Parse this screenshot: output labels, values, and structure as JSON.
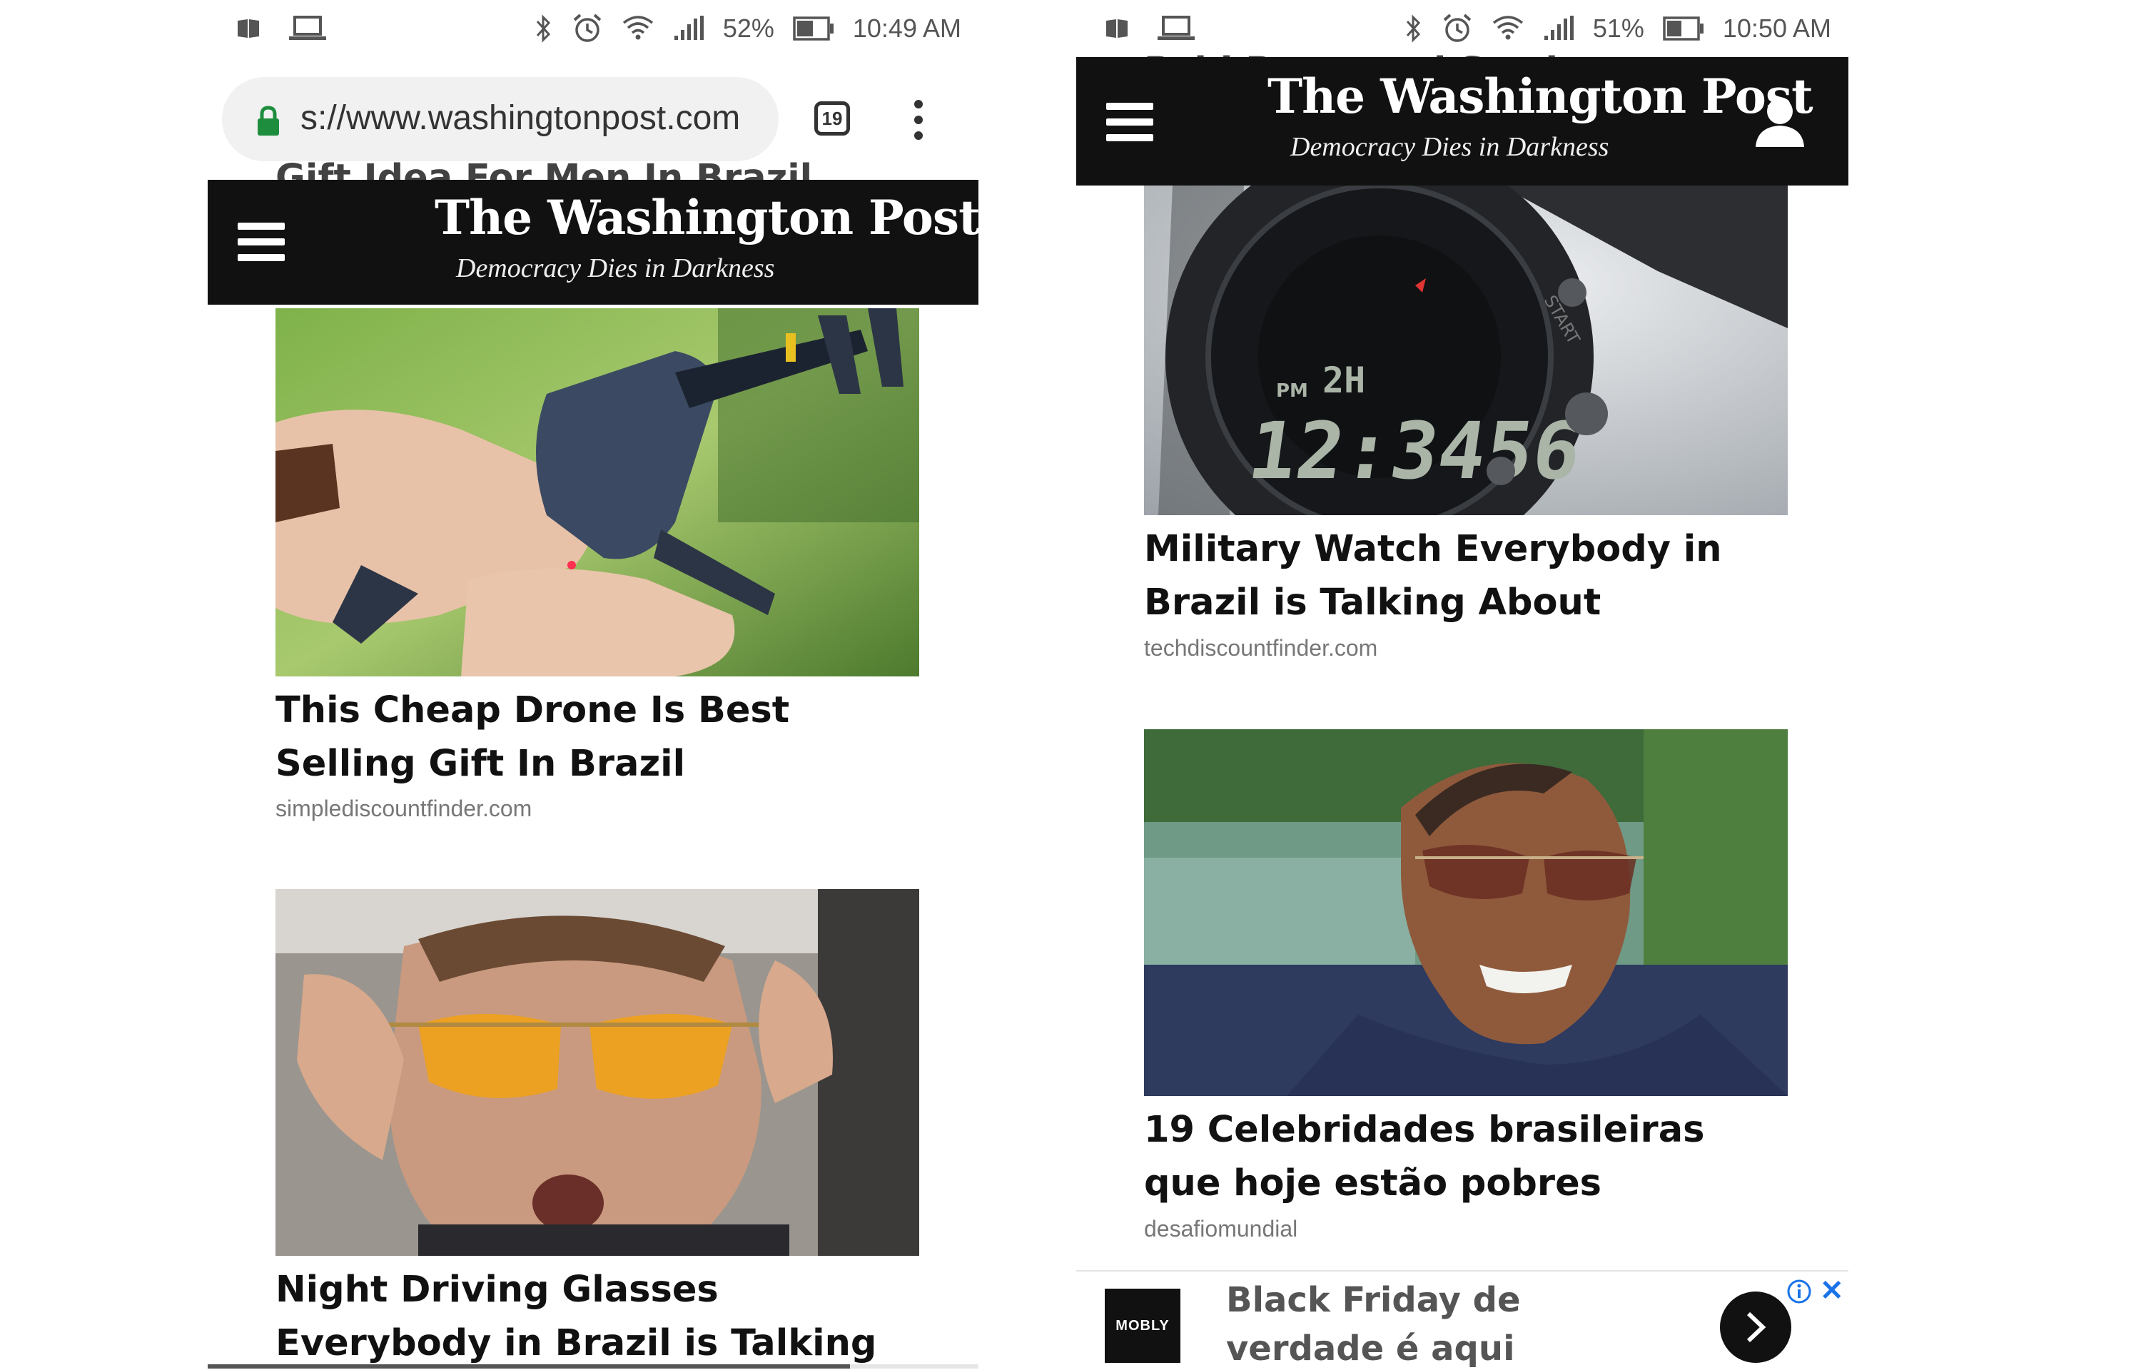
{
  "left": {
    "status": {
      "battery": "52%",
      "time": "10:49 AM"
    },
    "browser": {
      "url": "s://www.washingtonpost.com",
      "tab_count": "19"
    },
    "header": {
      "logo": "The Washington Post",
      "tagline": "Democracy Dies in Darkness"
    },
    "ghost_text": {
      "title_fragment": "Gift Idea For Men In Brazil",
      "source_fragment": "simplediscountfinder"
    },
    "cards": [
      {
        "title": "This Cheap Drone Is Best Selling Gift In Brazil",
        "source": "simplediscountfinder.com"
      },
      {
        "title": "Night Driving Glasses Everybody in Brazil is Talking About",
        "source": ""
      }
    ]
  },
  "right": {
    "status": {
      "battery": "51%",
      "time": "10:50 AM"
    },
    "header": {
      "logo": "The Washington Post",
      "tagline": "Democracy Dies in Darkness"
    },
    "ghost_text": {
      "section_fragment": "Paid Promoted Stories"
    },
    "cards": [
      {
        "title": "Military Watch Everybody in Brazil is Talking About",
        "source": "techdiscountfinder.com"
      },
      {
        "title": "19 Celebridades brasileiras que hoje estão pobres",
        "source": "desafiomundial"
      }
    ],
    "watch_display": {
      "top": "2H",
      "am_pm": "PM",
      "time": "12:3456",
      "bezel": "START"
    },
    "ad": {
      "brand": "MOBLY",
      "text": "Black Friday de verdade é aqui"
    }
  },
  "colors": {
    "header_bg": "#111111",
    "lock_green": "#1e8e3e",
    "ad_close_blue": "#1a73e8"
  }
}
